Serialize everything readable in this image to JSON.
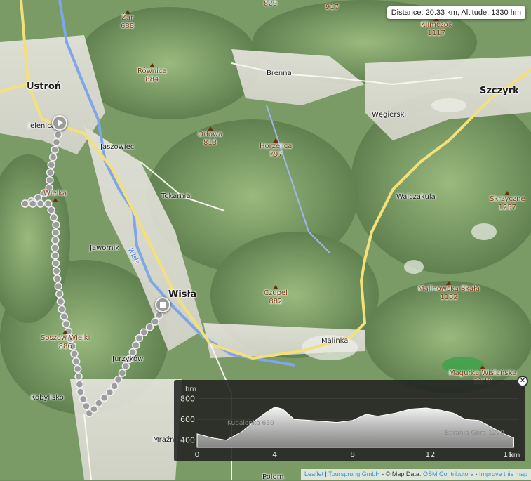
{
  "info_box": "Distance: 20.33 km, Altitude: 1330 hm",
  "towns": [
    {
      "name": "Ustroń",
      "kind": "town"
    },
    {
      "name": "Szczyrk",
      "kind": "town"
    },
    {
      "name": "Wisła",
      "kind": "town"
    },
    {
      "name": "Brenna",
      "kind": "village"
    },
    {
      "name": "Jelenica",
      "kind": "village"
    },
    {
      "name": "Jaszowiec",
      "kind": "village"
    },
    {
      "name": "Tokarnia",
      "kind": "village"
    },
    {
      "name": "Jawornik",
      "kind": "village"
    },
    {
      "name": "Węgierski",
      "kind": "village"
    },
    {
      "name": "Walczakula",
      "kind": "village"
    },
    {
      "name": "Malinka",
      "kind": "village"
    },
    {
      "name": "Kobylisko",
      "kind": "village"
    },
    {
      "name": "Jurzyków",
      "kind": "village"
    },
    {
      "name": "Mraźnica",
      "kind": "village"
    },
    {
      "name": "Polom",
      "kind": "village"
    }
  ],
  "peaks": [
    {
      "name": "Żar",
      "elevation": "688"
    },
    {
      "name": "Równica",
      "elevation": "884"
    },
    {
      "name": "Orłowa",
      "elevation": "813"
    },
    {
      "name": "Horzelica",
      "elevation": "797"
    },
    {
      "name": "Klimczok",
      "elevation": "1117"
    },
    {
      "name": "Skrzyczne",
      "elevation": "1257"
    },
    {
      "name": "Malinowska Skała",
      "elevation": "1152"
    },
    {
      "name": "Czupel",
      "elevation": "882"
    },
    {
      "name": "Soszów Wielki",
      "elevation": "886"
    },
    {
      "name": "Wielka",
      "elevation": ""
    },
    {
      "name": "Magurka Wiślańska",
      "elevation": "1140"
    },
    {
      "name": "",
      "elevation": "829"
    },
    {
      "name": "",
      "elevation": "917"
    }
  ],
  "river": "Wisła",
  "elevation_profile": {
    "y_unit": "hm",
    "x_unit": "km",
    "y_ticks": [
      "400",
      "600",
      "800"
    ],
    "x_ticks": [
      "0",
      "4",
      "8",
      "12",
      "16"
    ],
    "y_range": [
      330,
      900
    ],
    "x_range": [
      0,
      16.5
    ],
    "overlay_labels": [
      "Kubalonka 630",
      "Barania Góra 1220"
    ],
    "points": [
      [
        0,
        460
      ],
      [
        0.8,
        420
      ],
      [
        1.5,
        400
      ],
      [
        2.3,
        480
      ],
      [
        3,
        590
      ],
      [
        3.5,
        660
      ],
      [
        4,
        720
      ],
      [
        4.4,
        700
      ],
      [
        5,
        600
      ],
      [
        5.8,
        590
      ],
      [
        6.5,
        580
      ],
      [
        7.2,
        570
      ],
      [
        8,
        590
      ],
      [
        8.7,
        650
      ],
      [
        9.3,
        630
      ],
      [
        10.2,
        660
      ],
      [
        11,
        700
      ],
      [
        11.8,
        710
      ],
      [
        12.5,
        690
      ],
      [
        13.2,
        660
      ],
      [
        13.8,
        600
      ],
      [
        14.5,
        590
      ],
      [
        15.2,
        520
      ],
      [
        15.8,
        460
      ],
      [
        16.3,
        420
      ]
    ]
  },
  "attribution": {
    "leaflet": "Leaflet",
    "toursprung": "Toursprung GmbH",
    "mapdata_prefix": "© Map Data:",
    "osm": "OSM Contributors",
    "improve": "Improve this map"
  }
}
